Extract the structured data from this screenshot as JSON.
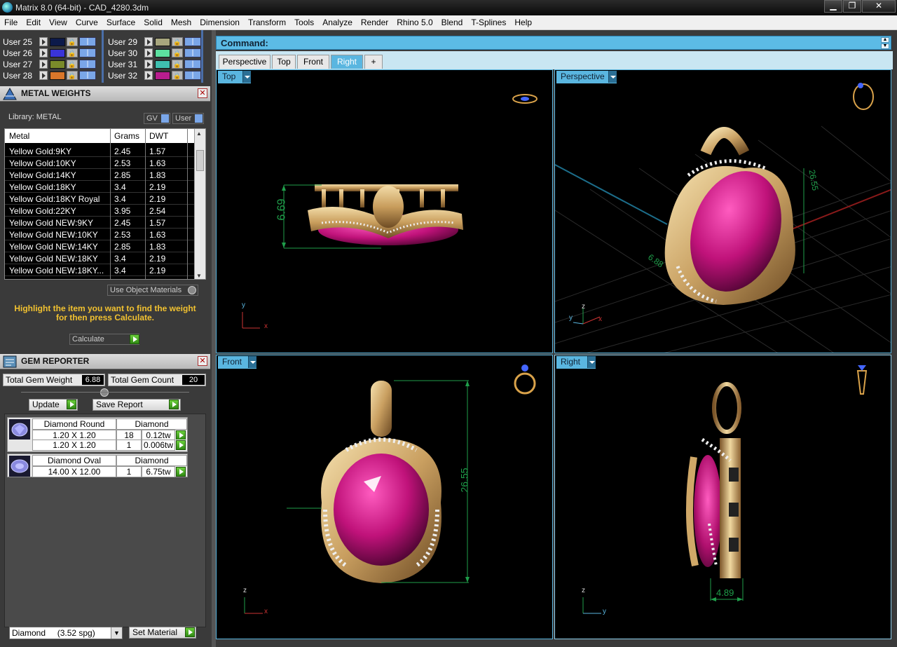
{
  "window": {
    "title": "Matrix 8.0 (64-bit) - CAD_4280.3dm",
    "min": "▁",
    "max": "❐",
    "close": "✕"
  },
  "menu": [
    "File",
    "Edit",
    "View",
    "Curve",
    "Surface",
    "Solid",
    "Mesh",
    "Dimension",
    "Transform",
    "Tools",
    "Analyze",
    "Render",
    "Rhino 5.0",
    "Blend",
    "T-Splines",
    "Help"
  ],
  "layers": {
    "left": [
      {
        "label": "User 25",
        "color": "#0c1a4a"
      },
      {
        "label": "User 26",
        "color": "#3a34d8"
      },
      {
        "label": "User 27",
        "color": "#7a8a2a"
      },
      {
        "label": "User 28",
        "color": "#d9762a"
      }
    ],
    "right": [
      {
        "label": "User 29",
        "color": "#a8a67e"
      },
      {
        "label": "User 30",
        "color": "#5ce0a0"
      },
      {
        "label": "User 31",
        "color": "#3fbfb0"
      },
      {
        "label": "User 32",
        "color": "#b81d8e"
      }
    ]
  },
  "metal_weights": {
    "title": "METAL WEIGHTS",
    "library_label": "Library: METAL",
    "toggle_gv": "GV",
    "toggle_user": "User",
    "columns": [
      "Metal",
      "Grams",
      "DWT"
    ],
    "rows": [
      [
        "Yellow Gold:9KY",
        "2.45",
        "1.57"
      ],
      [
        "Yellow Gold:10KY",
        "2.53",
        "1.63"
      ],
      [
        "Yellow Gold:14KY",
        "2.85",
        "1.83"
      ],
      [
        "Yellow Gold:18KY",
        "3.4",
        "2.19"
      ],
      [
        "Yellow Gold:18KY Royal",
        "3.4",
        "2.19"
      ],
      [
        "Yellow Gold:22KY",
        "3.95",
        "2.54"
      ],
      [
        "Yellow Gold NEW:9KY",
        "2.45",
        "1.57"
      ],
      [
        "Yellow Gold NEW:10KY",
        "2.53",
        "1.63"
      ],
      [
        "Yellow Gold NEW:14KY",
        "2.85",
        "1.83"
      ],
      [
        "Yellow Gold NEW:18KY",
        "3.4",
        "2.19"
      ],
      [
        "Yellow Gold NEW:18KY...",
        "3.4",
        "2.19"
      ]
    ],
    "use_object_materials": "Use Object Materials",
    "hint": "Highlight the item you want to find the weight for then press Calculate.",
    "calculate_label": "Calculate"
  },
  "gem_reporter": {
    "title": "GEM REPORTER",
    "total_weight_label": "Total Gem Weight",
    "total_weight_value": "6.88",
    "total_count_label": "Total Gem Count",
    "total_count_value": "20",
    "update_label": "Update",
    "save_report_label": "Save Report",
    "groups": [
      {
        "shape": "Diamond Round",
        "material": "Diamond",
        "rows": [
          {
            "size": "1.20 X 1.20",
            "count": "18",
            "weight": "0.12tw"
          },
          {
            "size": "1.20 X 1.20",
            "count": "1",
            "weight": "0.006tw"
          }
        ]
      },
      {
        "shape": "Diamond Oval",
        "material": "Diamond",
        "rows": [
          {
            "size": "14.00 X 12.00",
            "count": "1",
            "weight": "6.75tw"
          }
        ]
      }
    ],
    "material_select": "Diamond     (3.52 spg)",
    "set_material_label": "Set Material"
  },
  "command": {
    "label": "Command:"
  },
  "view_tabs": [
    "Perspective",
    "Top",
    "Front",
    "Right",
    "+"
  ],
  "active_tab": "Right",
  "viewports": {
    "top": {
      "label": "Top",
      "dimension": "6.69",
      "axis_y": "y",
      "axis_x": "x"
    },
    "perspective": {
      "label": "Perspective",
      "dimension_a": "26.55",
      "dimension_b": "6.88",
      "axis_z": "z",
      "axis_y": "y",
      "axis_x": "x"
    },
    "front": {
      "label": "Front",
      "dimension": "26.55",
      "axis_z": "z",
      "axis_x": "x"
    },
    "right": {
      "label": "Right",
      "dimension": "4.89",
      "axis_z": "z",
      "axis_y": "y"
    }
  },
  "colors": {
    "accent": "#5ab6e0",
    "gold": "#d9b77a",
    "ruby": "#c81a80",
    "dim_green": "#1f9e4a"
  }
}
